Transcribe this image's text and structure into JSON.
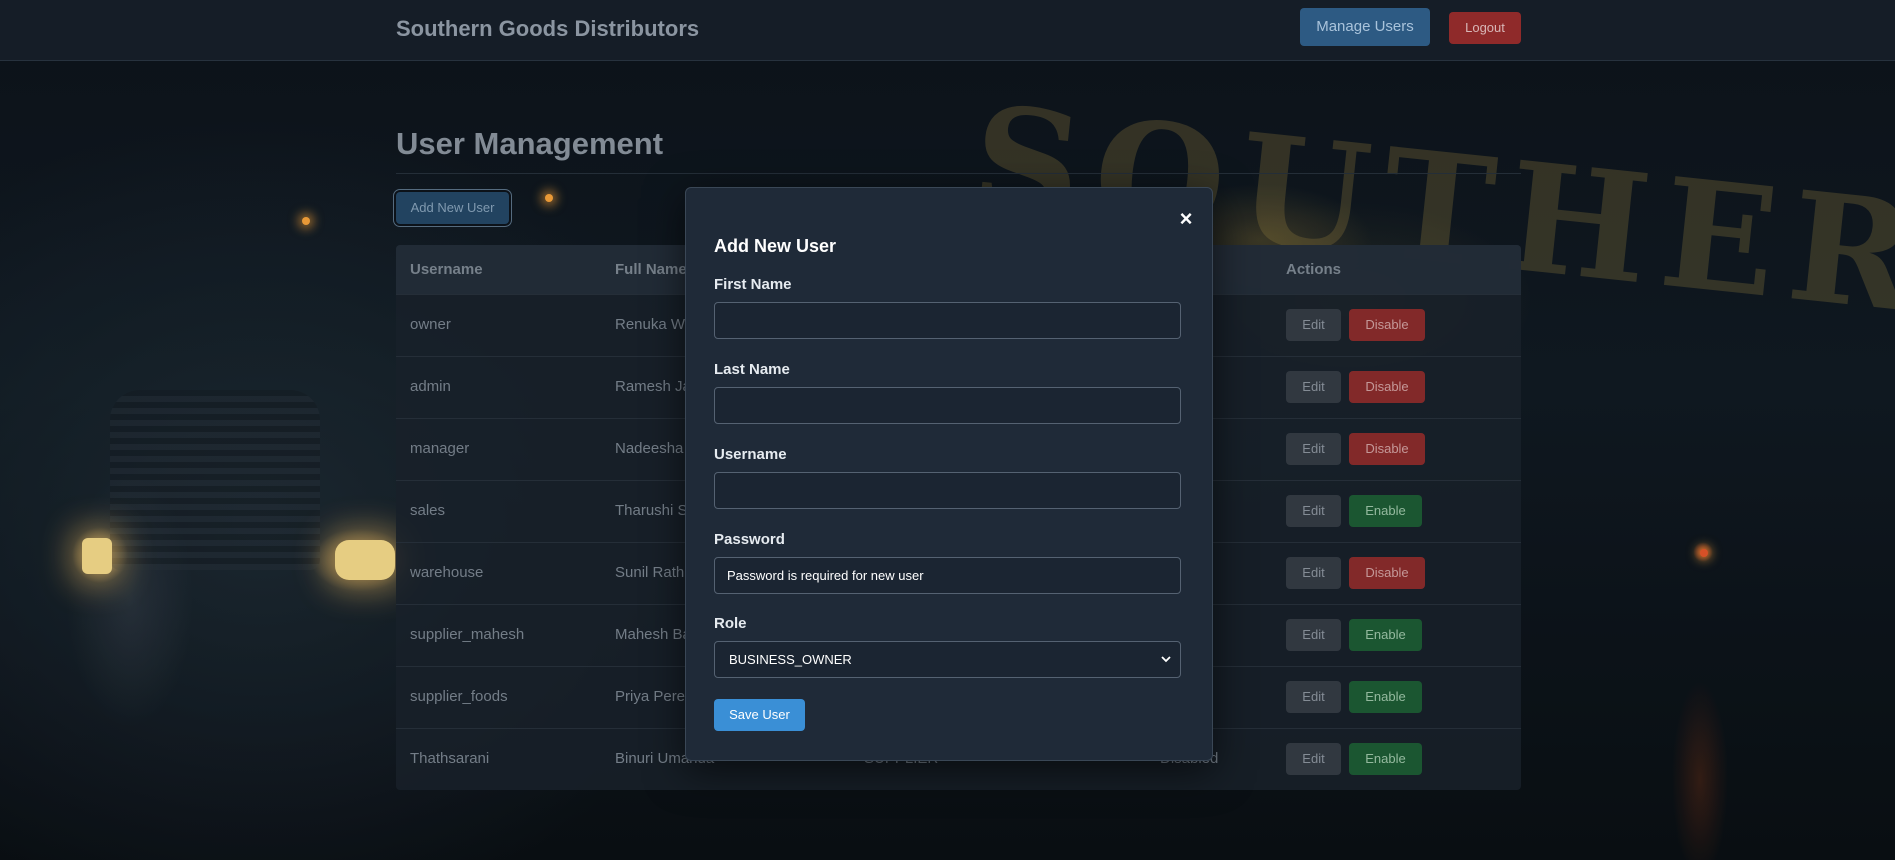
{
  "navbar": {
    "brand": "Southern Goods Distributors",
    "manage_users_label": "Manage Users",
    "logout_label": "Logout"
  },
  "page": {
    "title": "User Management",
    "add_user_label": "Add New User"
  },
  "table": {
    "headers": {
      "username": "Username",
      "full_name": "Full Name",
      "actions": "Actions"
    },
    "rows": [
      {
        "username": "owner",
        "full_name": "Renuka Wi",
        "role": "",
        "status": "",
        "edit": "Edit",
        "toggle": "Disable"
      },
      {
        "username": "admin",
        "full_name": "Ramesh Ja",
        "role": "",
        "status": "",
        "edit": "Edit",
        "toggle": "Disable"
      },
      {
        "username": "manager",
        "full_name": "Nadeesha",
        "role": "",
        "status": "",
        "edit": "Edit",
        "toggle": "Disable"
      },
      {
        "username": "sales",
        "full_name": "Tharushi S",
        "role": "",
        "status": "d",
        "edit": "Edit",
        "toggle": "Enable"
      },
      {
        "username": "warehouse",
        "full_name": "Sunil Rathn",
        "role": "",
        "status": "",
        "edit": "Edit",
        "toggle": "Disable"
      },
      {
        "username": "supplier_mahesh",
        "full_name": "Mahesh Ba",
        "role": "",
        "status": "d",
        "edit": "Edit",
        "toggle": "Enable"
      },
      {
        "username": "supplier_foods",
        "full_name": "Priya Perer",
        "role": "",
        "status": "d",
        "edit": "Edit",
        "toggle": "Enable"
      },
      {
        "username": "Thathsarani",
        "full_name": "Binuri Umanda",
        "role": "SUPPLIER",
        "status": "Disabled",
        "edit": "Edit",
        "toggle": "Enable"
      }
    ]
  },
  "modal": {
    "title": "Add New User",
    "close_symbol": "×",
    "first_name_label": "First Name",
    "first_name_value": "",
    "last_name_label": "Last Name",
    "last_name_value": "",
    "username_label": "Username",
    "username_value": "",
    "password_label": "Password",
    "password_placeholder": "Password is required for new user",
    "role_label": "Role",
    "role_value": "BUSINESS_OWNER",
    "save_label": "Save User"
  },
  "icons": {
    "close": "close-icon",
    "select_caret": "chevron-down-icon"
  },
  "colors": {
    "accent": "#3a8fd6",
    "danger": "#8a2c2c",
    "success": "#1d5b34"
  }
}
